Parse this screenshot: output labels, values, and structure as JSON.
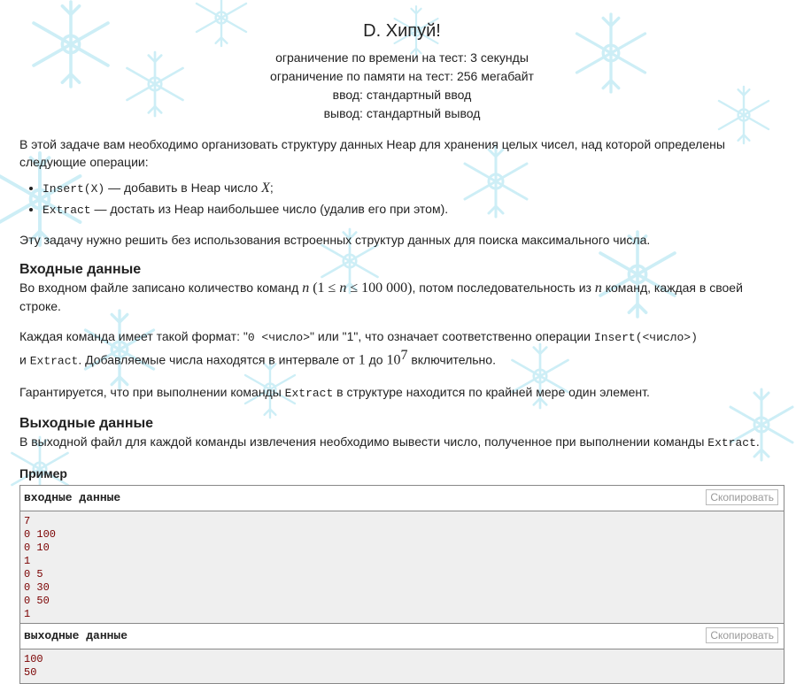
{
  "problem": {
    "title": "D. Хипуй!",
    "time_limit": "ограничение по времени на тест: 3 секунды",
    "memory_limit": "ограничение по памяти на тест: 256 мегабайт",
    "input": "ввод: стандартный ввод",
    "output": "вывод: стандартный вывод"
  },
  "statement": {
    "intro": "В этой задаче вам необходимо организовать структуру данных Heap для хранения целых чисел, над которой определены следующие операции:",
    "op1_code": "Insert(X)",
    "op1_text": " — добавить в Heap число ",
    "op1_var": "X",
    "op1_end": ";",
    "op2_code": "Extract",
    "op2_text": " — достать из Heap наибольшее число (удалив его при этом).",
    "note": "Эту задачу нужно решить без использования встроенных структур данных для поиска максимального числа."
  },
  "input_section": {
    "title": "Входные данные",
    "p1_a": "Во входном файле записано количество команд ",
    "p1_n": "n",
    "p1_range_open": " (1 ≤ ",
    "p1_range_n": "n",
    "p1_range_close": " ≤ 100 000)",
    "p1_b": ", потом последовательность из ",
    "p1_n2": "n",
    "p1_c": " команд, каждая в своей строке.",
    "p2_a": "Каждая команда имеет такой формат: \"",
    "p2_code1": "0 <число>",
    "p2_b": "\" или \"1\", что означает соответственно операции ",
    "p2_code2": "Insert(<число>)",
    "p2_c": " и ",
    "p2_code3": "Extract",
    "p2_d": ". Добавляемые числа находятся в интервале от ",
    "p2_one": "1",
    "p2_e": " до ",
    "p2_ten": "10",
    "p2_exp": "7",
    "p2_f": " включительно.",
    "p3_a": "Гарантируется, что при выполнении команды ",
    "p3_code": "Extract",
    "p3_b": " в структуре находится по крайней мере один элемент."
  },
  "output_section": {
    "title": "Выходные данные",
    "p_a": "В выходной файл для каждой команды извлечения необходимо вывести число, полученное при выполнении команды ",
    "p_code": "Extract",
    "p_b": "."
  },
  "example": {
    "title": "Пример",
    "input_label": "входные данные",
    "output_label": "выходные данные",
    "copy_label": "Скопировать",
    "input_text": "7\n0 100\n0 10\n1\n0 5\n0 30\n0 50\n1",
    "output_text": "100\n50"
  },
  "colors": {
    "accent_text": "#7a0000",
    "snowflake": "#cfeff7"
  }
}
